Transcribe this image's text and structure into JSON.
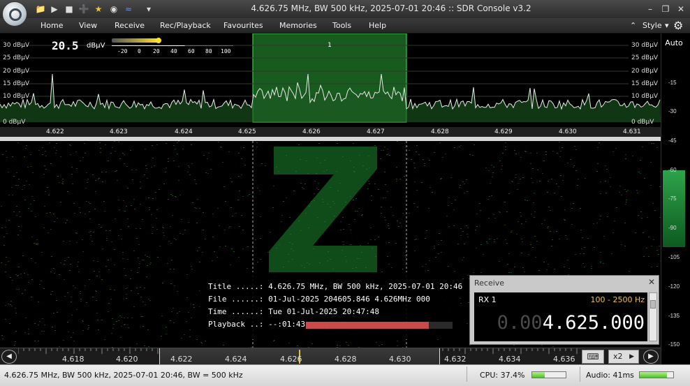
{
  "window": {
    "title": "4.626.75 MHz, BW 500 kHz, 2025-07-01 20:46 :: SDR Console v3.2"
  },
  "quick_access": [
    "folder-icon",
    "play-icon",
    "stop-icon",
    "add-icon",
    "star-icon",
    "camera-icon",
    "signal-icon"
  ],
  "menu": {
    "items": [
      "Home",
      "View",
      "Receive",
      "Rec/Playback",
      "Favourites",
      "Memories",
      "Tools",
      "Help"
    ],
    "style_label": "Style"
  },
  "spectrum": {
    "db_labels": [
      "30 dBµV",
      "25 dBµV",
      "20 dBµV",
      "15 dBµV",
      "10 dBµV",
      "0 dBµV"
    ],
    "signal_value": "20.5",
    "signal_unit": "dBµV",
    "smeter_ticks": [
      "-20",
      "0",
      "20",
      "40",
      "60",
      "80",
      "100"
    ],
    "vfo_marker": "1"
  },
  "frequency_axis": {
    "labels": [
      "4.622",
      "4.623",
      "4.624",
      "4.625",
      "4.626",
      "4.627",
      "4.628",
      "4.629",
      "4.630",
      "4.631"
    ]
  },
  "level_scale": {
    "auto_label": "Auto",
    "labels": [
      "-15",
      "-30",
      "-45",
      "-60",
      "-75",
      "-90",
      "-105",
      "-120",
      "-135",
      "-150"
    ]
  },
  "playback_info": {
    "title_row": "Title .....: 4.626.75 MHz, BW 500 kHz, 2025-07-01 20:46",
    "file_row": "File ......: 01-Jul-2025 204605.846 4.626MHz 000",
    "time_row": "Time ......: Tue 01-Jul-2025 20:47:48",
    "playback_row": "Playback ..: --:01:43",
    "progress_fraction": 0.84
  },
  "receive_panel": {
    "title": "Receive",
    "rx_label": "RX 1",
    "filter": "100 - 2500 Hz",
    "freq_dim": "0.00",
    "freq_main": "4.625.000"
  },
  "tuner": {
    "labels": [
      "4.618",
      "4.620",
      "4.622",
      "4.624",
      "4.626",
      "4.628",
      "4.630",
      "4.632",
      "4.634",
      "4.636"
    ],
    "zoom_label": "x2"
  },
  "statusbar": {
    "text": "4.626.75 MHz, BW 500 kHz, 2025-07-01 20:46, BW = 500 kHz",
    "cpu": "CPU: 37.4%",
    "cpu_fraction": 0.374,
    "audio": "Audio: 41ms",
    "audio_fraction": 0.82
  }
}
